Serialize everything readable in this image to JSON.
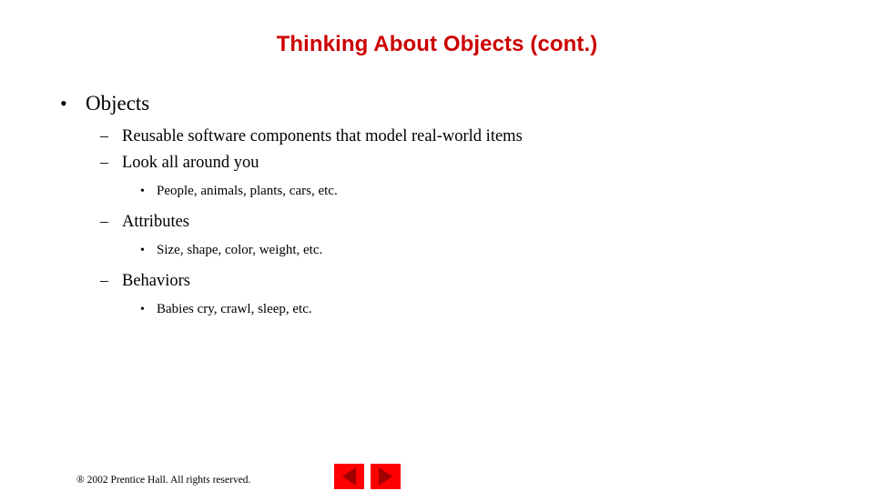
{
  "slide": {
    "title": "Thinking About Objects (cont.)",
    "title_color": "#cc0000",
    "background_color": "#ffffff"
  },
  "outline": {
    "level1": {
      "marker": "•",
      "text": "Objects"
    },
    "items": [
      {
        "level": 2,
        "marker": "–",
        "text": "Reusable software components that model real-world items"
      },
      {
        "level": 2,
        "marker": "–",
        "text": "Look all around you"
      },
      {
        "level": 3,
        "marker": "•",
        "text": "People, animals, plants, cars, etc."
      },
      {
        "level": 2,
        "marker": "–",
        "text": "Attributes"
      },
      {
        "level": 3,
        "marker": "•",
        "text": "Size, shape, color, weight, etc."
      },
      {
        "level": 2,
        "marker": "–",
        "text": "Behaviors"
      },
      {
        "level": 3,
        "marker": "•",
        "text": "Babies cry, crawl, sleep, etc."
      }
    ]
  },
  "footer": {
    "copyright": "® 2002 Prentice Hall.  All rights reserved.",
    "nav": {
      "previous_label": "previous-slide-triangle",
      "next_label": "next-slide-triangle",
      "button_color": "#fe0000",
      "triangle_color": "#a30000"
    }
  }
}
